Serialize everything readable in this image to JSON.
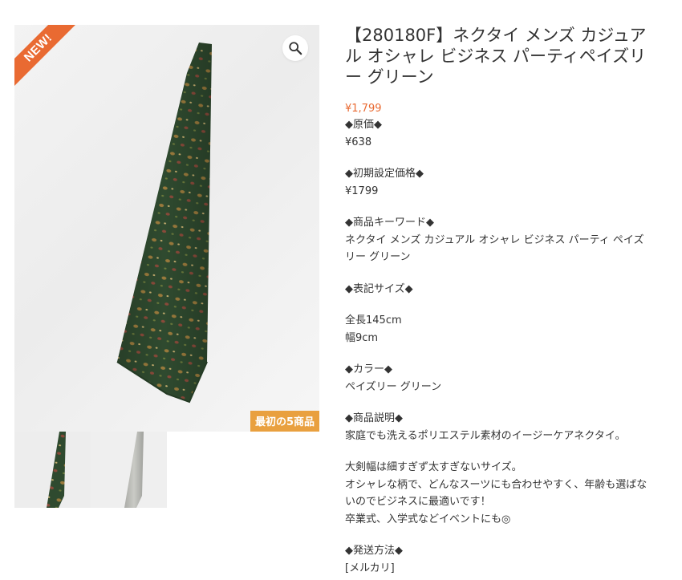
{
  "gallery": {
    "new_label": "NEW!",
    "promo_badge": "最初の5商品",
    "zoom_icon": "magnifier-icon",
    "thumbnails": [
      {
        "name": "green-tie-thumbnail"
      },
      {
        "name": "gray-tie-thumbnail"
      }
    ],
    "colors": {
      "ribbon": "#e96a32",
      "badge": "#e9a03f",
      "tie": "#2e4a2e"
    }
  },
  "product": {
    "title": "【280180F】ネクタイ メンズ カジュアル オシャレ ビジネス パーティペイズリー グリーン",
    "price": "¥1,799",
    "price_color": "#e96a32",
    "description": [
      "◆原価◆",
      "¥638",
      "",
      "◆初期設定価格◆",
      "¥1799",
      "",
      "◆商品キーワード◆",
      "ネクタイ メンズ カジュアル オシャレ ビジネス パーティ ペイズリー グリーン",
      "",
      "◆表記サイズ◆",
      "",
      "全長145cm",
      "幅9cm",
      "",
      "◆カラー◆",
      "ペイズリー グリーン",
      "",
      "◆商品説明◆",
      "家庭でも洗えるポリエステル素材のイージーケアネクタイ。",
      "",
      "大剣幅は細すぎず太すぎないサイズ。",
      "オシャレな柄で、どんなスーツにも合わせやすく、年齢も選ばないのでビジネスに最適いです！",
      "卒業式、入学式などイベントにも◎",
      "",
      "◆発送方法◆",
      "[メルカリ]"
    ]
  }
}
